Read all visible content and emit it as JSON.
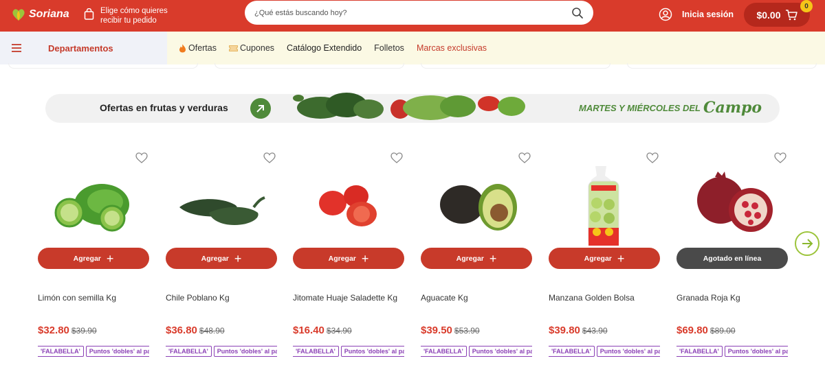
{
  "header": {
    "brand": "Soriana",
    "pickup_text": "Elige cómo quieres recibir tu pedido",
    "search_placeholder": "¿Qué estás buscando hoy?",
    "login_label": "Inicia sesión",
    "cart_total": "$0.00",
    "cart_count": "0"
  },
  "nav": {
    "departments_label": "Departamentos",
    "links": [
      {
        "label": "Ofertas",
        "icon": "fire-icon"
      },
      {
        "label": "Cupones",
        "icon": "coupon-icon"
      },
      {
        "label": "Catálogo Extendido"
      },
      {
        "label": "Folletos"
      },
      {
        "label": "Marcas exclusivas"
      }
    ]
  },
  "banner": {
    "title": "Ofertas en frutas y verduras",
    "promo_prefix": "MARTES Y MIÉRCOLES DEL",
    "promo_script": "Campo"
  },
  "products": [
    {
      "name": "Limón con semilla Kg",
      "price": "$32.80",
      "old_price": "$39.90",
      "button": "Agregar",
      "available": true,
      "tags": [
        "'FALABELLA'",
        "Puntos 'dobles' al pa"
      ]
    },
    {
      "name": "Chile Poblano Kg",
      "price": "$36.80",
      "old_price": "$48.90",
      "button": "Agregar",
      "available": true,
      "tags": [
        "'FALABELLA'",
        "Puntos 'dobles' al pa"
      ]
    },
    {
      "name": "Jitomate Huaje Saladette Kg",
      "price": "$16.40",
      "old_price": "$34.90",
      "button": "Agregar",
      "available": true,
      "tags": [
        "'FALABELLA'",
        "Puntos 'dobles' al pa"
      ]
    },
    {
      "name": "Aguacate Kg",
      "price": "$39.50",
      "old_price": "$53.90",
      "button": "Agregar",
      "available": true,
      "tags": [
        "'FALABELLA'",
        "Puntos 'dobles' al pa"
      ]
    },
    {
      "name": "Manzana Golden Bolsa",
      "price": "$39.80",
      "old_price": "$43.90",
      "button": "Agregar",
      "available": true,
      "tags": [
        "'FALABELLA'",
        "Puntos 'dobles' al pa"
      ]
    },
    {
      "name": "Granada Roja Kg",
      "price": "$69.80",
      "old_price": "$89.00",
      "button": "Agotado en línea",
      "available": false,
      "tags": [
        "'FALABELLA'",
        "Puntos 'dobles' al pa"
      ]
    }
  ],
  "colors": {
    "brand_red": "#d93b2b",
    "dark_red": "#b5281c",
    "green": "#4f8a3a",
    "tag_purple": "#8a3fb5"
  }
}
